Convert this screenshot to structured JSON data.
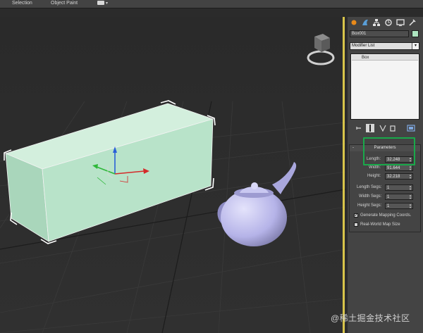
{
  "menubar": {
    "items": [
      {
        "label": "Selection"
      },
      {
        "label": "Object Paint"
      }
    ]
  },
  "command_panel": {
    "tabs": [
      "create-icon",
      "modify-icon",
      "hierarchy-icon",
      "motion-icon",
      "display-icon",
      "utilities-icon"
    ],
    "object_name": "Box001",
    "object_color": "#aee5c0",
    "modifier_list": "Modifier List",
    "stack_items": [
      "Box"
    ],
    "parameters": {
      "title": "Parameters",
      "length_label": "Length:",
      "length_value": "32.248",
      "width_label": "Width:",
      "width_value": "91.644",
      "height_label": "Height:",
      "height_value": "32.218",
      "length_segs_label": "Length Segs:",
      "length_segs_value": "1",
      "width_segs_label": "Width Segs:",
      "width_segs_value": "1",
      "height_segs_label": "Height Segs:",
      "height_segs_value": "1",
      "generate_mapping_label": "Generate Mapping Coords.",
      "generate_mapping_checked": true,
      "real_world_label": "Real-World Map Size",
      "real_world_checked": false
    }
  },
  "scene": {
    "box_color": "#b8e3c9",
    "teapot_color": "#b5b3e8",
    "gizmo_colors": {
      "x": "#d42a2a",
      "y": "#2fb83a",
      "z": "#2a5fd8"
    }
  },
  "watermark": "@稀土掘金技术社区"
}
